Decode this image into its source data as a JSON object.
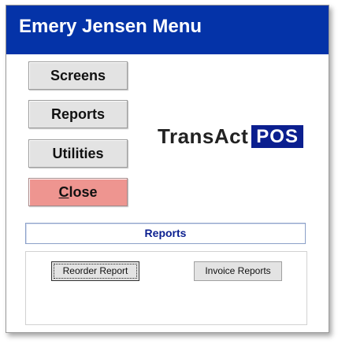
{
  "window": {
    "title": "Emery Jensen Menu"
  },
  "menu": {
    "screens_label": "Screens",
    "reports_label": "Reports",
    "utilities_label": "Utilities",
    "close_label": "Close"
  },
  "logo": {
    "text": "TransAct",
    "badge": "POS"
  },
  "reports_section": {
    "header": "Reports",
    "reorder_label": "Reorder Report",
    "invoice_label": "Invoice Reports"
  },
  "colors": {
    "title_bar": "#0433a8",
    "close_button": "#ee9590",
    "logo_badge": "#0b1f8f",
    "section_header_text": "#0b1f8f"
  }
}
